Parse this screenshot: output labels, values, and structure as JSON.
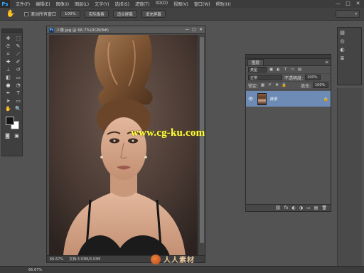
{
  "app": {
    "logo": "Ps"
  },
  "menu": [
    "文件(F)",
    "编辑(E)",
    "图像(I)",
    "图层(L)",
    "文字(Y)",
    "选择(S)",
    "滤镜(T)",
    "3D(D)",
    "视图(V)",
    "窗口(W)",
    "帮助(H)"
  ],
  "window_buttons": [
    "—",
    "□",
    "✕"
  ],
  "options_bar": {
    "scroll_all_label": "滚动所有窗口",
    "buttons": [
      "100%",
      "实际像素",
      "适合屏幕",
      "填充屏幕"
    ],
    "workspace_label": "▾"
  },
  "tools": [
    "move",
    "marquee",
    "lasso",
    "quick-select",
    "crop",
    "eyedropper",
    "healing",
    "brush",
    "clone",
    "history-brush",
    "eraser",
    "gradient",
    "blur",
    "dodge",
    "pen",
    "type",
    "path-select",
    "shape",
    "hand",
    "zoom"
  ],
  "document": {
    "title": "人像.jpg @ 66.7%(RGB/8#)",
    "buttons": [
      "—",
      "□",
      "✕"
    ],
    "status_zoom": "66.67%",
    "status_doc": "文档:3.93M/3.93M",
    "watermark": "www.cg-ku.com"
  },
  "layers_panel": {
    "tab": "图层",
    "menu_icon": "≡",
    "filter_kind": "类型",
    "blend_mode": "正常",
    "opacity_label": "不透明度:",
    "opacity_value": "100%",
    "lock_label": "锁定:",
    "fill_label": "填充:",
    "fill_value": "100%",
    "layer_name": "背景",
    "bottom_icons": [
      "⛓",
      "fx",
      "◐",
      "◑",
      "▭",
      "▤",
      "🗑"
    ]
  },
  "dock": {
    "items": [
      {
        "icon": "▤",
        "label": ""
      },
      {
        "icon": "◎",
        "label": ""
      },
      {
        "icon": "◐",
        "label": ""
      },
      {
        "icon": "≣",
        "label": ""
      }
    ]
  },
  "status_bar": {
    "text": "66.67%"
  },
  "brand_watermark": "人人素材",
  "colors": {
    "foreground": "#151515",
    "background": "#ffffff",
    "selection": "#6d8bb5",
    "watermark_text": "#ffff44"
  }
}
